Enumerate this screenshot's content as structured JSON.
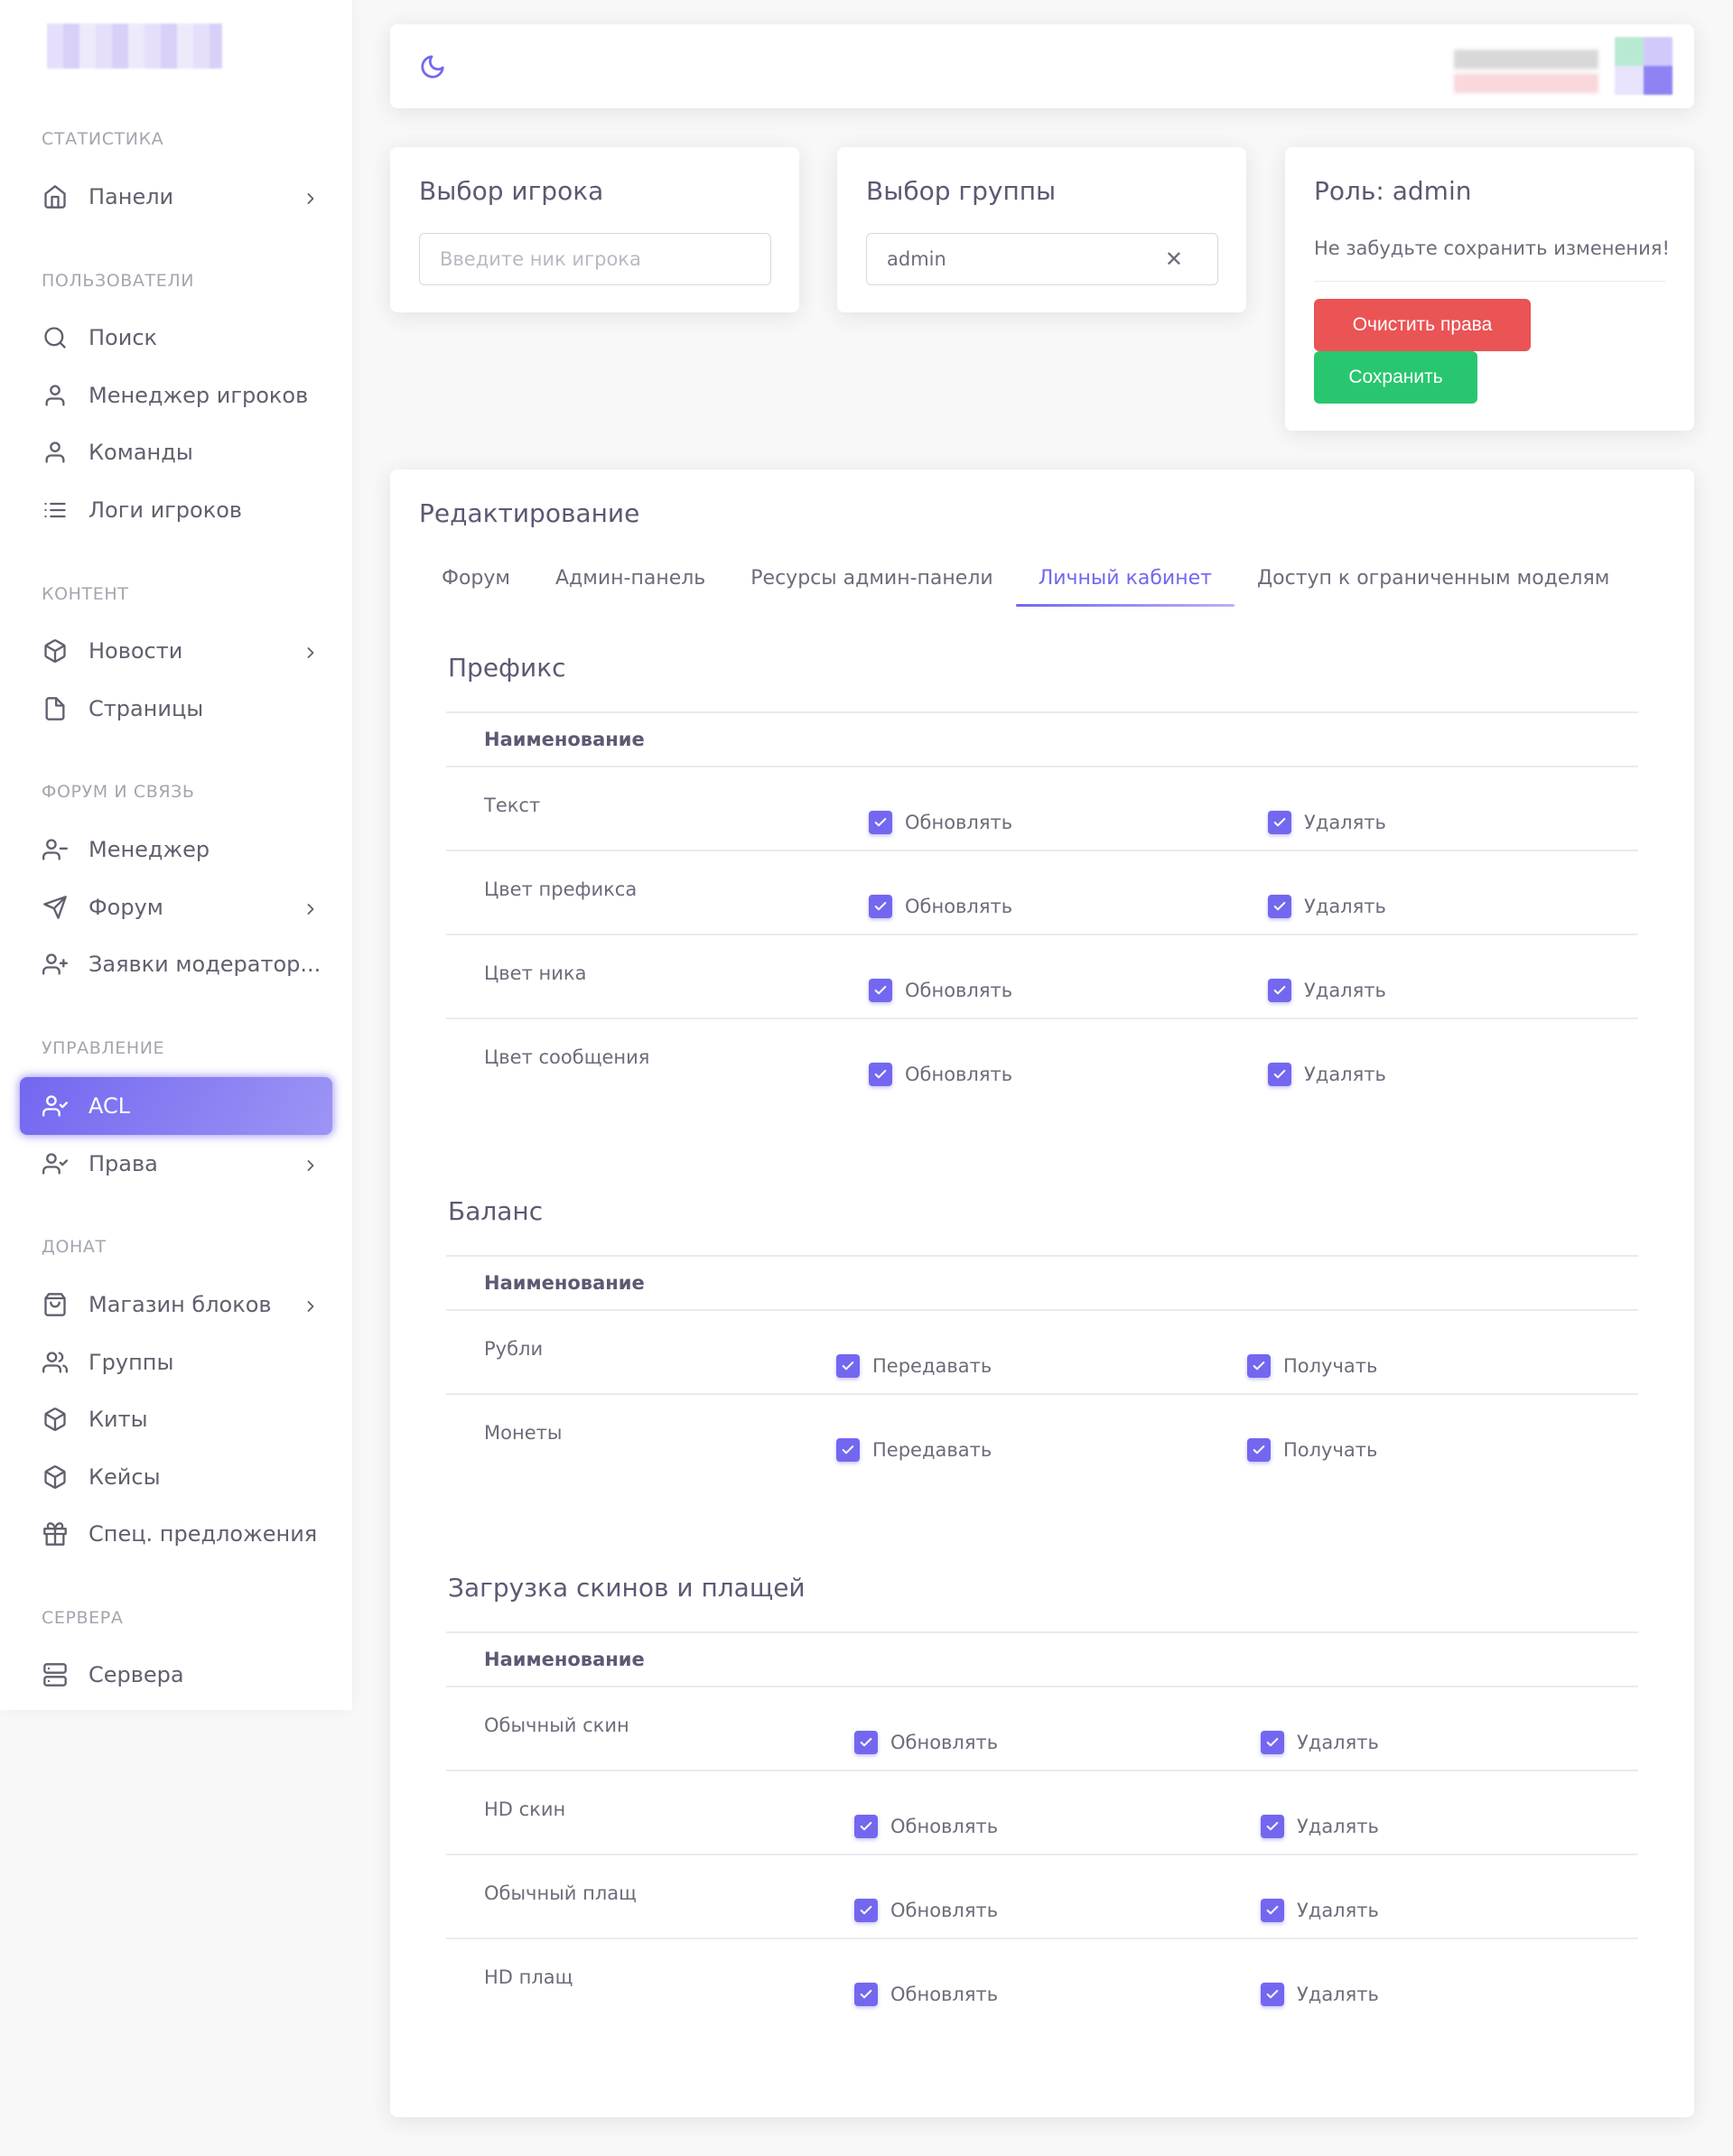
{
  "sidebar": {
    "sections": [
      {
        "title": "Статистика",
        "items": [
          {
            "label": "Панели",
            "icon": "home-icon",
            "chevron": true
          }
        ]
      },
      {
        "title": "Пользователи",
        "items": [
          {
            "label": "Поиск",
            "icon": "search-icon"
          },
          {
            "label": "Менеджер игроков",
            "icon": "user-icon"
          },
          {
            "label": "Команды",
            "icon": "user-icon"
          },
          {
            "label": "Логи игроков",
            "icon": "list-icon"
          }
        ]
      },
      {
        "title": "Контент",
        "items": [
          {
            "label": "Новости",
            "icon": "package-icon",
            "chevron": true
          },
          {
            "label": "Страницы",
            "icon": "file-icon"
          }
        ]
      },
      {
        "title": "Форум и связь",
        "items": [
          {
            "label": "Менеджер",
            "icon": "user-minus-icon"
          },
          {
            "label": "Форум",
            "icon": "send-icon",
            "chevron": true
          },
          {
            "label": "Заявки модератор...",
            "icon": "user-plus-icon"
          }
        ]
      },
      {
        "title": "Управление",
        "items": [
          {
            "label": "ACL",
            "icon": "user-check-icon",
            "active": true
          },
          {
            "label": "Права",
            "icon": "user-check-icon",
            "chevron": true
          }
        ]
      },
      {
        "title": "Донат",
        "items": [
          {
            "label": "Магазин блоков",
            "icon": "shopping-bag-icon",
            "chevron": true
          },
          {
            "label": "Группы",
            "icon": "users-icon"
          },
          {
            "label": "Киты",
            "icon": "package-icon"
          },
          {
            "label": "Кейсы",
            "icon": "package-icon"
          },
          {
            "label": "Спец. предложения",
            "icon": "gift-icon"
          }
        ]
      },
      {
        "title": "Сервера",
        "items": [
          {
            "label": "Сервера",
            "icon": "server-icon"
          }
        ]
      }
    ]
  },
  "navbar": {
    "theme_icon": "moon-icon"
  },
  "player_card": {
    "title": "Выбор игрока",
    "placeholder": "Введите ник игрока"
  },
  "group_card": {
    "title": "Выбор группы",
    "value": "admin"
  },
  "role_card": {
    "title": "Роль: admin",
    "hint": "Не забудьте сохранить изменения!",
    "clear_label": "Очистить права",
    "save_label": "Сохранить"
  },
  "edit": {
    "title": "Редактирование",
    "tabs": [
      "Форум",
      "Админ-панель",
      "Ресурсы админ-панели",
      "Личный кабинет",
      "Доступ к ограниченным моделям"
    ],
    "active_tab": "Личный кабинет",
    "column_header": "Наименование",
    "sections": [
      {
        "title": "Префикс",
        "rows": [
          {
            "name": "Текст",
            "perm1": "Обновлять",
            "perm2": "Удалять"
          },
          {
            "name": "Цвет префикса",
            "perm1": "Обновлять",
            "perm2": "Удалять"
          },
          {
            "name": "Цвет ника",
            "perm1": "Обновлять",
            "perm2": "Удалять"
          },
          {
            "name": "Цвет сообщения",
            "perm1": "Обновлять",
            "perm2": "Удалять"
          }
        ]
      },
      {
        "title": "Баланс",
        "rows": [
          {
            "name": "Рубли",
            "perm1": "Передавать",
            "perm2": "Получать"
          },
          {
            "name": "Монеты",
            "perm1": "Передавать",
            "perm2": "Получать"
          }
        ]
      },
      {
        "title": "Загрузка скинов и плащей",
        "rows": [
          {
            "name": "Обычный скин",
            "perm1": "Обновлять",
            "perm2": "Удалять"
          },
          {
            "name": "HD скин",
            "perm1": "Обновлять",
            "perm2": "Удалять"
          },
          {
            "name": "Обычный плащ",
            "perm1": "Обновлять",
            "perm2": "Удалять"
          },
          {
            "name": "HD плащ",
            "perm1": "Обновлять",
            "perm2": "Удалять"
          }
        ]
      }
    ]
  },
  "colors": {
    "primary": "#7367f0",
    "danger": "#ea5455",
    "success": "#28c76f"
  }
}
